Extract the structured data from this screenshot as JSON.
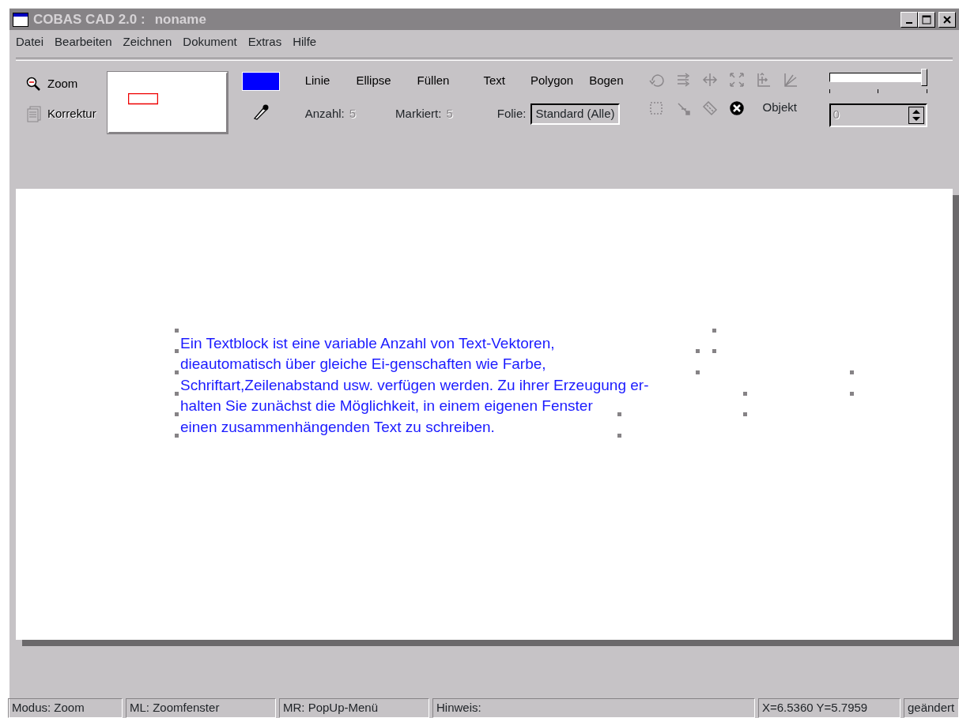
{
  "window": {
    "title": "COBAS CAD 2.0 :",
    "document": "noname"
  },
  "menu": [
    "Datei",
    "Bearbeiten",
    "Zeichnen",
    "Dokument",
    "Extras",
    "Hilfe"
  ],
  "toolbar": {
    "zoom": {
      "label": "Zoom",
      "disabled": false
    },
    "korrektur": {
      "label": "Korrektur",
      "disabled": true
    },
    "color": "#0000ff",
    "tools": [
      "Linie",
      "Ellipse",
      "Füllen",
      "Text",
      "Polygon",
      "Bogen"
    ],
    "anzahl": {
      "label": "Anzahl:",
      "value": "5"
    },
    "markiert": {
      "label": "Markiert:",
      "value": "5"
    },
    "folie": {
      "label": "Folie:",
      "value": "Standard (Alle)"
    },
    "icon_buttons": [
      {
        "kind": "rotate",
        "disabled": true
      },
      {
        "kind": "align",
        "disabled": true
      },
      {
        "kind": "move",
        "disabled": true
      },
      {
        "kind": "scale",
        "disabled": true
      },
      {
        "kind": "axis",
        "disabled": true
      },
      {
        "kind": "angle",
        "disabled": true
      },
      {
        "kind": "select",
        "disabled": true
      },
      {
        "kind": "node",
        "disabled": true
      },
      {
        "kind": "ruler",
        "disabled": true
      },
      {
        "kind": "delete",
        "disabled": false
      }
    ],
    "objekt_label": "Objekt",
    "slider": {
      "level": 1
    },
    "spinner": {
      "value": "0",
      "disabled": true
    }
  },
  "canvas": {
    "text_lines": [
      "Ein Textblock ist eine variable Anzahl von Text-Vektoren,",
      "dieautomatisch über gleiche Ei-genschaften wie Farbe,",
      "Schriftart,Zeilenabstand usw. verfügen werden. Zu ihrer Erzeugung er-",
      "halten Sie zunächst die Möglichkeit, in einem eigenen Fenster",
      "einen zusammenhängenden Text zu schreiben."
    ]
  },
  "status_bar": [
    "Modus:  Zoom",
    "ML:  Zoomfenster",
    "MR:  PopUp-Menü",
    "Hinweis:",
    "X=6.5360 Y=5.7959",
    "geändert"
  ]
}
